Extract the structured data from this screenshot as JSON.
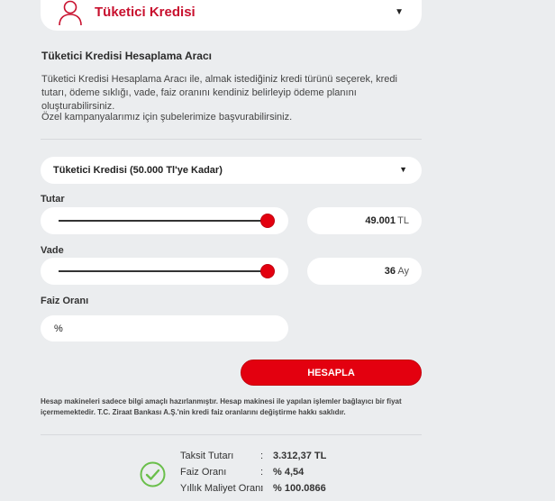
{
  "header": {
    "title": "Tüketici Kredisi",
    "icon": "user-outline-icon",
    "dropdown_icon": "caret-down-icon"
  },
  "intro": {
    "title": "Tüketici Kredisi Hesaplama Aracı",
    "description": "Tüketici Kredisi Hesaplama Aracı ile, almak istediğiniz kredi türünü seçerek, kredi tutarı, ödeme sıklığı, vade, faiz oranını kendiniz belirleyip ödeme planını oluşturabilirsiniz.",
    "campaign_note": "Özel kampanyalarımız için şubelerimize başvurabilirsiniz."
  },
  "loan_type": {
    "selected": "Tüketici Kredisi (50.000 Tl'ye Kadar)"
  },
  "amount": {
    "label": "Tutar",
    "value": "49.001",
    "unit": "TL",
    "slider_fraction": 0.98
  },
  "term": {
    "label": "Vade",
    "value": "36",
    "unit": "Ay",
    "slider_fraction": 0.98
  },
  "interest": {
    "label": "Faiz Oranı",
    "placeholder": "%"
  },
  "calculate_button": {
    "label": "HESAPLA"
  },
  "disclaimer": "Hesap makineleri sadece bilgi amaçlı hazırlanmıştır. Hesap makinesi ile yapılan işlemler bağlayıcı bir fiyat içermemektedir. T.C. Ziraat Bankası A.Ş.'nin kredi faiz oranlarını değiştirme hakkı saklıdır.",
  "results": {
    "icon": "check-circle-icon",
    "rows": [
      {
        "key": "Taksit Tutarı",
        "sep": ":",
        "value": "3.312,37 TL"
      },
      {
        "key": "Faiz Oranı",
        "sep": ":",
        "value": "% 4,54"
      },
      {
        "key": "Yıllık Maliyet Oranı",
        "sep": ":",
        "value": "% 100.0866"
      }
    ]
  },
  "colors": {
    "accent": "#e3000f",
    "background": "#ebedef",
    "success": "#6abf4b"
  }
}
